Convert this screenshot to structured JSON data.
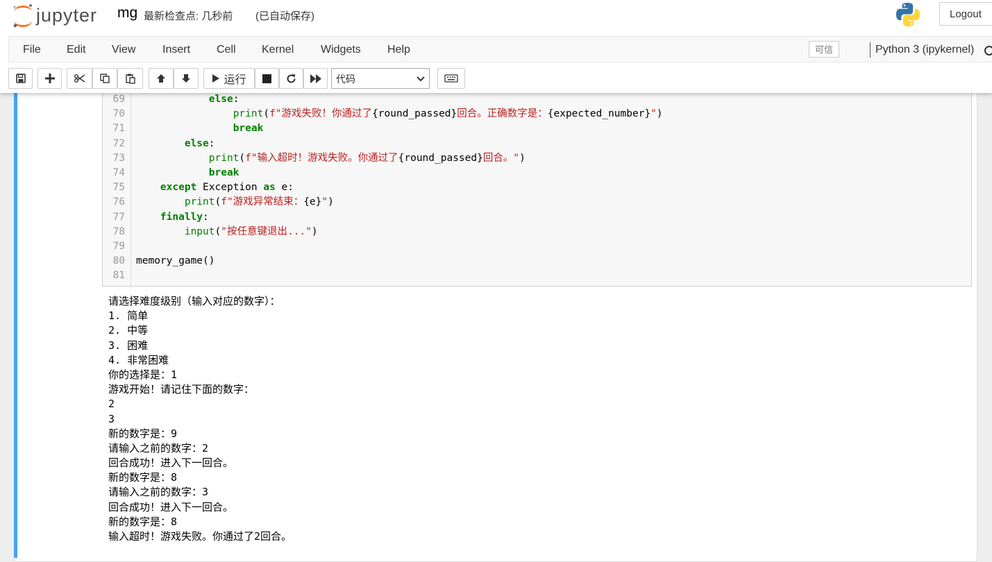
{
  "header": {
    "logo_text": "jupyter",
    "notebook_name": "mg",
    "checkpoint": "最新检查点: 几秒前",
    "autosave": "(已自动保存)",
    "logout_label": "Logout"
  },
  "menubar": {
    "items": [
      "File",
      "Edit",
      "View",
      "Insert",
      "Cell",
      "Kernel",
      "Widgets",
      "Help"
    ],
    "trusted": "可信",
    "kernel": "Python 3 (ipykernel)"
  },
  "toolbar": {
    "run_label": "运行",
    "cell_type": "代码",
    "icons": [
      "save-icon",
      "plus-icon",
      "cut-icon",
      "copy-icon",
      "paste-icon",
      "arrow-up-icon",
      "arrow-down-icon",
      "run-icon",
      "stop-icon",
      "restart-icon",
      "fast-forward-icon",
      "keyboard-icon"
    ]
  },
  "code_lines": [
    {
      "n": "69",
      "indent": "            ",
      "tokens": [
        [
          "kw",
          "else"
        ],
        [
          "pn",
          ":"
        ]
      ]
    },
    {
      "n": "70",
      "indent": "                ",
      "tokens": [
        [
          "bi",
          "print"
        ],
        [
          "pn",
          "("
        ],
        [
          "st",
          "f\"游戏失败！你通过了"
        ],
        [
          "pn",
          "{round_passed}"
        ],
        [
          "st",
          "回合。正确数字是："
        ],
        [
          "pn",
          "{expected_number}"
        ],
        [
          "st",
          "\""
        ],
        [
          "pn",
          ")"
        ]
      ]
    },
    {
      "n": "71",
      "indent": "                ",
      "tokens": [
        [
          "kw",
          "break"
        ]
      ]
    },
    {
      "n": "72",
      "indent": "        ",
      "tokens": [
        [
          "kw",
          "else"
        ],
        [
          "pn",
          ":"
        ]
      ]
    },
    {
      "n": "73",
      "indent": "            ",
      "tokens": [
        [
          "bi",
          "print"
        ],
        [
          "pn",
          "("
        ],
        [
          "st",
          "f\"输入超时！游戏失败。你通过了"
        ],
        [
          "pn",
          "{round_passed}"
        ],
        [
          "st",
          "回合。\""
        ],
        [
          "pn",
          ")"
        ]
      ]
    },
    {
      "n": "74",
      "indent": "            ",
      "tokens": [
        [
          "kw",
          "break"
        ]
      ]
    },
    {
      "n": "75",
      "indent": "    ",
      "tokens": [
        [
          "kw",
          "except"
        ],
        [
          "pn",
          " Exception "
        ],
        [
          "kw",
          "as"
        ],
        [
          "pn",
          " e:"
        ]
      ]
    },
    {
      "n": "76",
      "indent": "        ",
      "tokens": [
        [
          "bi",
          "print"
        ],
        [
          "pn",
          "("
        ],
        [
          "st",
          "f\"游戏异常结束："
        ],
        [
          "pn",
          "{e}"
        ],
        [
          "st",
          "\""
        ],
        [
          "pn",
          ")"
        ]
      ]
    },
    {
      "n": "77",
      "indent": "    ",
      "tokens": [
        [
          "kw",
          "finally"
        ],
        [
          "pn",
          ":"
        ]
      ]
    },
    {
      "n": "78",
      "indent": "        ",
      "tokens": [
        [
          "bi",
          "input"
        ],
        [
          "pn",
          "("
        ],
        [
          "st",
          "\"按任意键退出...\""
        ],
        [
          "pn",
          ")"
        ]
      ]
    },
    {
      "n": "79",
      "indent": "",
      "tokens": []
    },
    {
      "n": "80",
      "indent": "",
      "tokens": [
        [
          "pn",
          "memory_game()"
        ]
      ]
    },
    {
      "n": "81",
      "indent": "",
      "tokens": []
    }
  ],
  "output_lines": [
    "请选择难度级别（输入对应的数字）：",
    "1. 简单",
    "2. 中等",
    "3. 困难",
    "4. 非常困难",
    "你的选择是：1",
    "游戏开始！请记住下面的数字：",
    "2",
    "3",
    "新的数字是：9",
    "请输入之前的数字：2",
    "回合成功！进入下一回合。",
    "新的数字是：8",
    "请输入之前的数字：3",
    "回合成功！进入下一回合。",
    "新的数字是：8",
    "输入超时！游戏失败。你通过了2回合。"
  ],
  "colors": {
    "keyword": "#008000",
    "string": "#ba2121",
    "cell_selected_bar": "#42a5f5",
    "logo_orange": "#f37726"
  }
}
